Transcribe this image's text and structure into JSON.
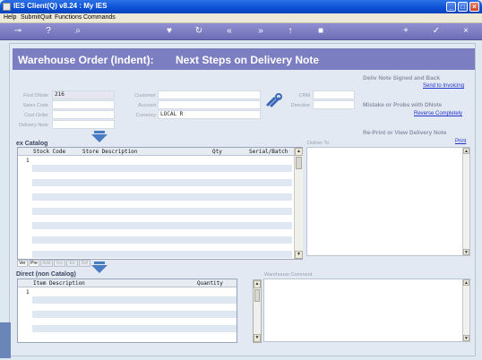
{
  "window": {
    "title": "IES Client(Q) v8.24 : My IES"
  },
  "menu": [
    "Help",
    "Submit",
    "Quit",
    "Functions",
    "Commands"
  ],
  "toolbar_icons": [
    "key-icon",
    "help-icon",
    "search-icon",
    "heart-icon",
    "refresh-icon",
    "rewind-icon",
    "fast-forward-icon",
    "export-icon",
    "stop-icon",
    "add-icon",
    "ok-icon",
    "close-icon"
  ],
  "banner": {
    "title": "Warehouse Order (Indent):",
    "subtitle": "Next Steps on Delivery Note"
  },
  "fields": {
    "find_dnote": {
      "label": "Find DNote",
      "value": "216"
    },
    "sales_code": {
      "label": "Sales Code",
      "value": ""
    },
    "cost_order": {
      "label": "Cost Order",
      "value": ""
    },
    "delivery_note": {
      "label": "Delivery Note",
      "value": ""
    },
    "customer": {
      "label": "Customer",
      "value": ""
    },
    "account": {
      "label": "Account",
      "value": ""
    },
    "currency": {
      "label": "Currency",
      "value": "LOCAL R"
    },
    "crm": {
      "label": "CRM",
      "value": ""
    },
    "directive": {
      "label": "Directive",
      "value": ""
    }
  },
  "right_actions": {
    "signed_title": "Deliv Note Signed and Back",
    "signed_link": "Send to Invoicing",
    "mistake_title": "Mistake or Probs with DNote",
    "mistake_link": "Reverse Completely",
    "reprint_title": "Re-Print or View Delivery Note",
    "reprint_link": "Print"
  },
  "catalog": {
    "title": "ex Catalog",
    "columns": [
      "Stock Code",
      "Store Description",
      "Qty",
      "Serial/Batch"
    ],
    "row_number": "1",
    "deliver_to_label": "Deliver To"
  },
  "tabs": [
    "Ver",
    "Pre",
    "Add",
    "Ins",
    "Ex",
    "Del"
  ],
  "direct": {
    "title": "Direct (non Catalog)",
    "columns": [
      "Item Description",
      "Quantity"
    ],
    "row_number": "1",
    "comment_label": "Warehouse Comment"
  },
  "colors": {
    "banner": "#7c7ec2",
    "toolbar": "#7a7ac0",
    "link": "#2233cc"
  }
}
